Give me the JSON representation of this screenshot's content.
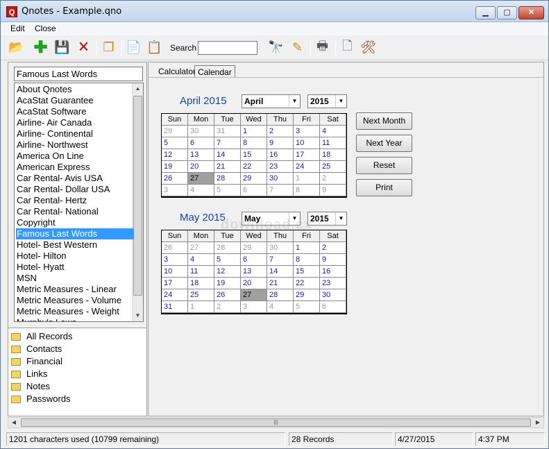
{
  "window": {
    "title": "Qnotes - Example.qno",
    "icon_letter": "Q"
  },
  "menu": [
    {
      "label": "Edit"
    },
    {
      "label": "Close"
    }
  ],
  "toolbar": {
    "search_label": "Search",
    "search_value": ""
  },
  "record": {
    "title": "Famous Last Words",
    "items": [
      "About Qnotes",
      "AcaStat Guarantee",
      "AcaStat Software",
      "Airline- Air Canada",
      "Airline- Continental",
      "Airline- Northwest",
      "America On Line",
      "American Express",
      "Car Rental- Avis USA",
      "Car Rental- Dollar USA",
      "Car Rental- Hertz",
      "Car Rental- National",
      "Copyright",
      "Famous Last Words",
      "Hotel- Best Western",
      "Hotel- Hilton",
      "Hotel- Hyatt",
      "MSN",
      "Metric Measures - Linear",
      "Metric Measures - Volume",
      "Metric Measures - Weight",
      "Murphy's Laws"
    ],
    "selected_index": 13
  },
  "categories": [
    "All Records",
    "Contacts",
    "Financial",
    "Links",
    "Notes",
    "Passwords"
  ],
  "tabs": [
    {
      "label": "Calculator"
    },
    {
      "label": "Calendar"
    }
  ],
  "active_tab": 1,
  "calendar": {
    "weekdays": [
      "Sun",
      "Mon",
      "Tue",
      "Wed",
      "Thu",
      "Fri",
      "Sat"
    ],
    "months": [
      {
        "title": "April 2015",
        "month_value": "April",
        "year_value": "2015",
        "weeks": [
          [
            "29",
            "30",
            "31",
            "1",
            "2",
            "3",
            "4"
          ],
          [
            "5",
            "6",
            "7",
            "8",
            "9",
            "10",
            "11"
          ],
          [
            "12",
            "13",
            "14",
            "15",
            "16",
            "17",
            "18"
          ],
          [
            "19",
            "20",
            "21",
            "22",
            "23",
            "24",
            "25"
          ],
          [
            "26",
            "27",
            "28",
            "29",
            "30",
            "1",
            "2"
          ],
          [
            "3",
            "4",
            "5",
            "6",
            "7",
            "8",
            "9"
          ]
        ],
        "first_in_month": 3,
        "days_in_month": 30,
        "today": "27"
      },
      {
        "title": "May 2015",
        "month_value": "May",
        "year_value": "2015",
        "weeks": [
          [
            "26",
            "27",
            "28",
            "29",
            "30",
            "1",
            "2"
          ],
          [
            "3",
            "4",
            "5",
            "6",
            "7",
            "8",
            "9"
          ],
          [
            "10",
            "11",
            "12",
            "13",
            "14",
            "15",
            "16"
          ],
          [
            "17",
            "18",
            "19",
            "20",
            "21",
            "22",
            "23"
          ],
          [
            "24",
            "25",
            "26",
            "27",
            "28",
            "29",
            "30"
          ],
          [
            "31",
            "1",
            "2",
            "3",
            "4",
            "5",
            "6"
          ]
        ],
        "first_in_month": 5,
        "days_in_month": 31,
        "today": "27"
      }
    ],
    "buttons": {
      "next_month": "Next Month",
      "next_year": "Next Year",
      "reset": "Reset",
      "print": "Print"
    }
  },
  "watermark": "download.cx",
  "status": {
    "chars": "1201 characters used (10799 remaining)",
    "records": "28 Records",
    "date": "4/27/2015",
    "time": "4:37 PM"
  }
}
